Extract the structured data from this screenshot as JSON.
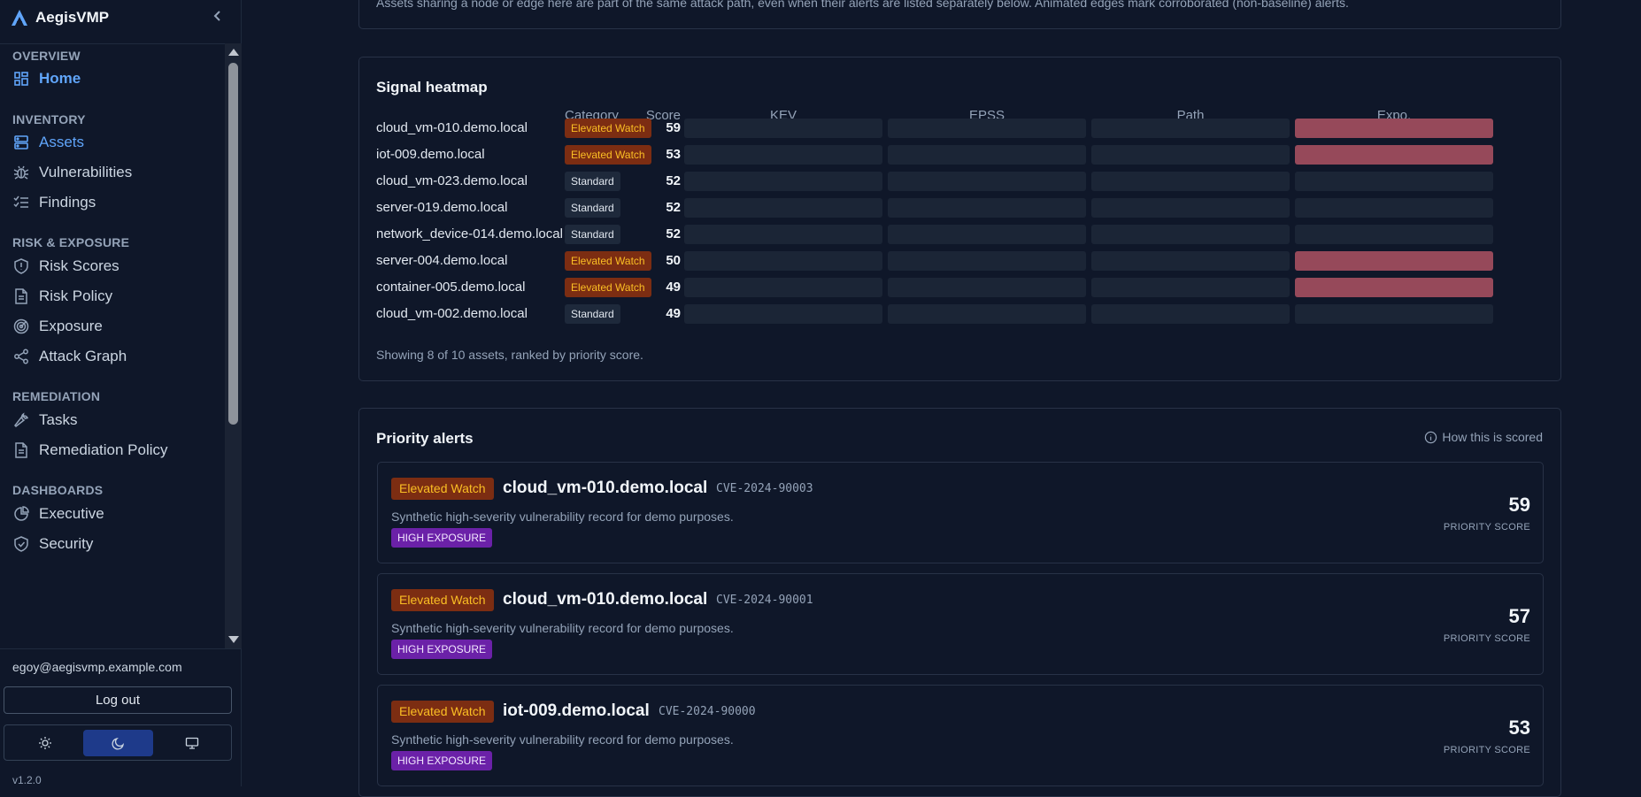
{
  "app": {
    "name": "AegisVMP",
    "version": "v1.2.0"
  },
  "sidebar": {
    "sections": [
      {
        "label": "OVERVIEW",
        "items": [
          {
            "label": "Home",
            "icon": "grid-icon"
          }
        ]
      },
      {
        "label": "INVENTORY",
        "items": [
          {
            "label": "Assets",
            "icon": "server-icon"
          },
          {
            "label": "Vulnerabilities",
            "icon": "bug-icon"
          },
          {
            "label": "Findings",
            "icon": "list-check-icon"
          }
        ]
      },
      {
        "label": "RISK & EXPOSURE",
        "items": [
          {
            "label": "Risk Scores",
            "icon": "shield-alert-icon"
          },
          {
            "label": "Risk Policy",
            "icon": "document-icon"
          },
          {
            "label": "Exposure",
            "icon": "radar-icon"
          },
          {
            "label": "Attack Graph",
            "icon": "share-icon"
          }
        ]
      },
      {
        "label": "REMEDIATION",
        "items": [
          {
            "label": "Tasks",
            "icon": "wrench-icon"
          },
          {
            "label": "Remediation Policy",
            "icon": "document-icon"
          }
        ]
      },
      {
        "label": "DASHBOARDS",
        "items": [
          {
            "label": "Executive",
            "icon": "pie-chart-icon"
          },
          {
            "label": "Security",
            "icon": "shield-check-icon"
          }
        ]
      }
    ],
    "user_email": "egoy@aegisvmp.example.com",
    "logout_label": "Log out",
    "theme_options": [
      "light",
      "dark",
      "system"
    ],
    "theme_selected": "dark"
  },
  "top_note": "Assets sharing a node or edge here are part of the same attack path, even when their alerts are listed separately below. Animated edges mark corroborated (non-baseline) alerts.",
  "heatmap": {
    "title": "Signal heatmap",
    "columns": {
      "category": "Category",
      "score": "Score",
      "signals": [
        "KEV",
        "EPSS",
        "Path",
        "Expo."
      ]
    },
    "rows": [
      {
        "host": "cloud_vm-010.demo.local",
        "category": "Elevated Watch",
        "score": "59",
        "signals": [
          0,
          0,
          0,
          1
        ]
      },
      {
        "host": "iot-009.demo.local",
        "category": "Elevated Watch",
        "score": "53",
        "signals": [
          0,
          0,
          0,
          1
        ]
      },
      {
        "host": "cloud_vm-023.demo.local",
        "category": "Standard",
        "score": "52",
        "signals": [
          0,
          0,
          0,
          0
        ]
      },
      {
        "host": "server-019.demo.local",
        "category": "Standard",
        "score": "52",
        "signals": [
          0,
          0,
          0,
          0
        ]
      },
      {
        "host": "network_device-014.demo.local",
        "category": "Standard",
        "score": "52",
        "signals": [
          0,
          0,
          0,
          0
        ]
      },
      {
        "host": "server-004.demo.local",
        "category": "Elevated Watch",
        "score": "50",
        "signals": [
          0,
          0,
          0,
          1
        ]
      },
      {
        "host": "container-005.demo.local",
        "category": "Elevated Watch",
        "score": "49",
        "signals": [
          0,
          0,
          0,
          1
        ]
      },
      {
        "host": "cloud_vm-002.demo.local",
        "category": "Standard",
        "score": "49",
        "signals": [
          0,
          0,
          0,
          0
        ]
      }
    ],
    "footer": "Showing 8 of 10 assets, ranked by priority score."
  },
  "priority": {
    "title": "Priority alerts",
    "how_label": "How this is scored",
    "score_label": "PRIORITY SCORE",
    "alerts": [
      {
        "category": "Elevated Watch",
        "host": "cloud_vm-010.demo.local",
        "cve": "CVE-2024-90003",
        "desc": "Synthetic high-severity vulnerability record for demo purposes.",
        "tag": "HIGH EXPOSURE",
        "score": "59"
      },
      {
        "category": "Elevated Watch",
        "host": "cloud_vm-010.demo.local",
        "cve": "CVE-2024-90001",
        "desc": "Synthetic high-severity vulnerability record for demo purposes.",
        "tag": "HIGH EXPOSURE",
        "score": "57"
      },
      {
        "category": "Elevated Watch",
        "host": "iot-009.demo.local",
        "cve": "CVE-2024-90000",
        "desc": "Synthetic high-severity vulnerability record for demo purposes.",
        "tag": "HIGH EXPOSURE",
        "score": "53"
      }
    ]
  },
  "colors": {
    "accent": "#60a5fa",
    "elevated_bg": "#7c2d12",
    "elevated_fg": "#fbbf24",
    "hot_cell": "#96495a",
    "exposure_tag": "#6b21a8"
  }
}
